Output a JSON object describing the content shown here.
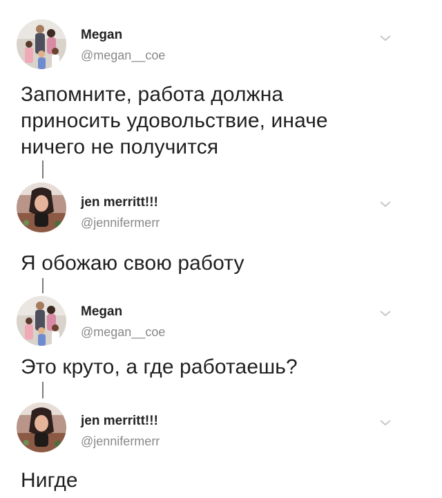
{
  "tweets": [
    {
      "name": "Megan",
      "handle": "@megan__coe",
      "text_lines": [
        "Запомните, работа должна",
        "приносить удовольствие, иначе",
        "ничего не получится"
      ]
    },
    {
      "name": "jen merritt!!!",
      "handle": "@jennifermerr",
      "text_lines": [
        "Я обожаю свою работу"
      ]
    },
    {
      "name": "Megan",
      "handle": "@megan__coe",
      "text_lines": [
        "Это круто, а где работаешь?"
      ]
    },
    {
      "name": "jen merritt!!!",
      "handle": "@jennifermerr",
      "text_lines": [
        "Нигде"
      ]
    }
  ],
  "icons": {
    "menu": "chevron-down-icon",
    "avatar_megan": "family-photo-avatar",
    "avatar_jen": "upside-down-photo-avatar"
  },
  "colors": {
    "text": "#1f1f1f",
    "handle": "#888888",
    "chevron": "#c7c7c7",
    "thread_line": "#7a7a7a"
  }
}
